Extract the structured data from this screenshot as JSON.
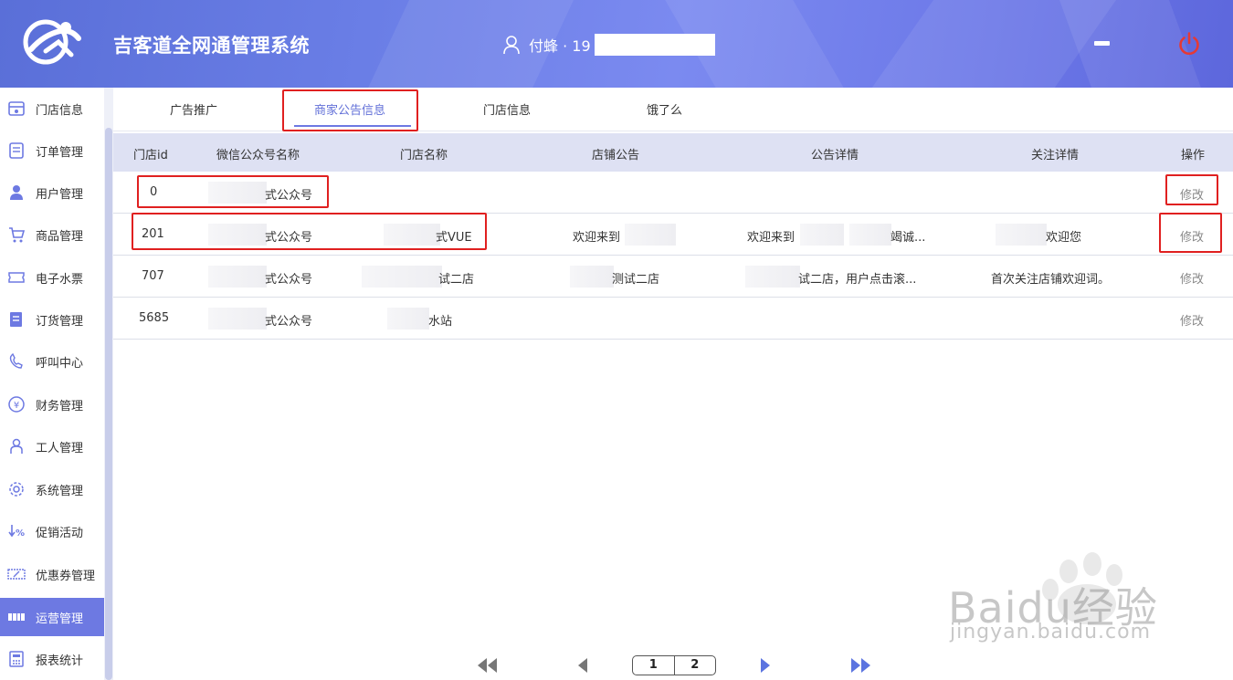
{
  "header": {
    "title": "吉客道全网通管理系统",
    "user_name": "付蜂 · 19",
    "colors": {
      "accent": "#6d79e2",
      "power": "#e53935"
    }
  },
  "sidebar": {
    "items": [
      {
        "label": "门店信息",
        "icon": "store-info-icon"
      },
      {
        "label": "订单管理",
        "icon": "order-icon"
      },
      {
        "label": "用户管理",
        "icon": "user-icon"
      },
      {
        "label": "商品管理",
        "icon": "cart-icon"
      },
      {
        "label": "电子水票",
        "icon": "ticket-icon"
      },
      {
        "label": "订货管理",
        "icon": "purchase-icon"
      },
      {
        "label": "呼叫中心",
        "icon": "phone-icon"
      },
      {
        "label": "财务管理",
        "icon": "yen-icon"
      },
      {
        "label": "工人管理",
        "icon": "worker-icon"
      },
      {
        "label": "系统管理",
        "icon": "gear-icon"
      },
      {
        "label": "促销活动",
        "icon": "discount-icon"
      },
      {
        "label": "优惠券管理",
        "icon": "coupon-icon"
      },
      {
        "label": "运营管理",
        "icon": "operation-icon",
        "active": true
      },
      {
        "label": "报表统计",
        "icon": "report-icon"
      }
    ]
  },
  "tabs": [
    {
      "label": "广告推广"
    },
    {
      "label": "商家公告信息",
      "active": true
    },
    {
      "label": "门店信息"
    },
    {
      "label": "饿了么"
    }
  ],
  "table": {
    "columns": [
      "门店id",
      "微信公众号名称",
      "门店名称",
      "店铺公告",
      "公告详情",
      "关注详情",
      "操作"
    ],
    "rows": [
      {
        "id": "0",
        "wechat": "式公众号",
        "store": "",
        "notice": "",
        "detail": "",
        "follow": "",
        "action": "修改"
      },
      {
        "id": "201",
        "wechat": "式公众号",
        "store": "式VUE",
        "notice": "欢迎来到",
        "detail": "欢迎来到",
        "detail_b": "竭诚...",
        "follow": "欢迎您",
        "action": "修改"
      },
      {
        "id": "707",
        "wechat": "式公众号",
        "store": "试二店",
        "notice": "测试二店",
        "detail": "试二店，用户点击滚...",
        "follow": "首次关注店铺欢迎词。",
        "action": "修改"
      },
      {
        "id": "5685",
        "wechat": "式公众号",
        "store": "水站",
        "notice": "",
        "detail": "",
        "follow": "",
        "action": "修改"
      }
    ]
  },
  "pagination": {
    "pages": [
      "1",
      "2"
    ],
    "current": "1"
  },
  "watermark": {
    "brand": "Baidu经验",
    "url": "jingyan.baidu.com"
  }
}
